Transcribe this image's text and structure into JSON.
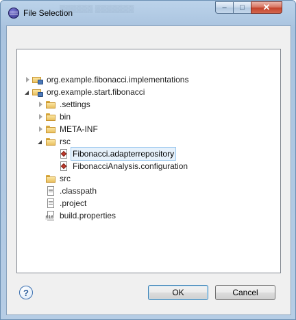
{
  "window": {
    "title": "File Selection",
    "title_ghost": "▒▒▒▒▒▒ ▒▒▒▒▒▒▒",
    "controls": {
      "minimize": "–",
      "maximize": "□",
      "close": "✕"
    }
  },
  "tree": {
    "items": [
      {
        "label": "org.example.fibonacci.implementations",
        "icon": "project-icon",
        "twisty": "collapsed"
      },
      {
        "label": "org.example.start.fibonacci",
        "icon": "project-icon",
        "twisty": "expanded"
      },
      {
        "label": ".settings",
        "icon": "folder-icon",
        "twisty": "collapsed"
      },
      {
        "label": "bin",
        "icon": "folder-icon",
        "twisty": "collapsed"
      },
      {
        "label": "META-INF",
        "icon": "folder-icon",
        "twisty": "collapsed"
      },
      {
        "label": "rsc",
        "icon": "folder-icon",
        "twisty": "expanded"
      },
      {
        "label": "Fibonacci.adapterrepository",
        "icon": "model-icon",
        "twisty": "none",
        "selected": true
      },
      {
        "label": "FibonacciAnalysis.configuration",
        "icon": "model-icon",
        "twisty": "none"
      },
      {
        "label": "src",
        "icon": "folder-icon",
        "twisty": "none"
      },
      {
        "label": ".classpath",
        "icon": "file-icon",
        "twisty": "none"
      },
      {
        "label": ".project",
        "icon": "file-icon",
        "twisty": "none"
      },
      {
        "label": "build.properties",
        "icon": "props-icon",
        "twisty": "none"
      }
    ]
  },
  "buttons": {
    "help": "?",
    "ok": "OK",
    "cancel": "Cancel"
  },
  "colors": {
    "selection_bg": "#e6f1fb",
    "selection_border": "#99c7ee",
    "titlebar": "#bcd3ea"
  }
}
